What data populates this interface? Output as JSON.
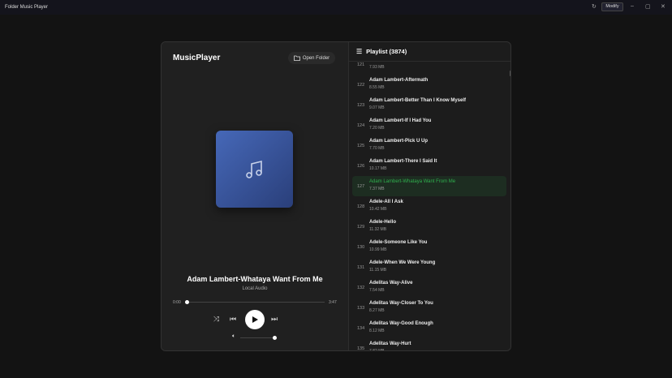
{
  "window": {
    "title": "Folder Music Player",
    "modify_label": "Modify"
  },
  "player": {
    "brand": "MusicPlayer",
    "open_folder_label": "Open Folder",
    "song_title": "Adam Lambert-Whataya Want From Me",
    "source": "Local Audio",
    "elapsed": "0:00",
    "duration": "3:47",
    "progress": 0,
    "volume": 0.9
  },
  "playlist": {
    "title": "Playlist (3874)",
    "active_index": 6,
    "items": [
      {
        "num": "121",
        "title": "",
        "size": "7.93 MB"
      },
      {
        "num": "122",
        "title": "Adam Lambert-Aftermath",
        "size": "8.55 MB"
      },
      {
        "num": "123",
        "title": "Adam Lambert-Better Than I Know Myself",
        "size": "9.07 MB"
      },
      {
        "num": "124",
        "title": "Adam Lambert-If I Had You",
        "size": "7.20 MB"
      },
      {
        "num": "125",
        "title": "Adam Lambert-Pick U Up",
        "size": "7.70 MB"
      },
      {
        "num": "126",
        "title": "Adam Lambert-There I Said It",
        "size": "10.17 MB"
      },
      {
        "num": "127",
        "title": "Adam Lambert-Whataya Want From Me",
        "size": "7.37 MB"
      },
      {
        "num": "128",
        "title": "Adele-All I Ask",
        "size": "10.42 MB"
      },
      {
        "num": "129",
        "title": "Adele-Hello",
        "size": "11.32 MB"
      },
      {
        "num": "130",
        "title": "Adele-Someone Like You",
        "size": "10.99 MB"
      },
      {
        "num": "131",
        "title": "Adele-When We Were Young",
        "size": "11.15 MB"
      },
      {
        "num": "132",
        "title": "Adelitas Way-Alive",
        "size": "7.54 MB"
      },
      {
        "num": "133",
        "title": "Adelitas Way-Closer To You",
        "size": "8.27 MB"
      },
      {
        "num": "134",
        "title": "Adelitas Way-Good Enough",
        "size": "8.12 MB"
      },
      {
        "num": "135",
        "title": "Adelitas Way-Hurt",
        "size": "7.82 MB"
      }
    ]
  },
  "colors": {
    "accent": "#2fb04e",
    "art_gradient_start": "#4668b8",
    "art_gradient_end": "#2a3f7a"
  }
}
